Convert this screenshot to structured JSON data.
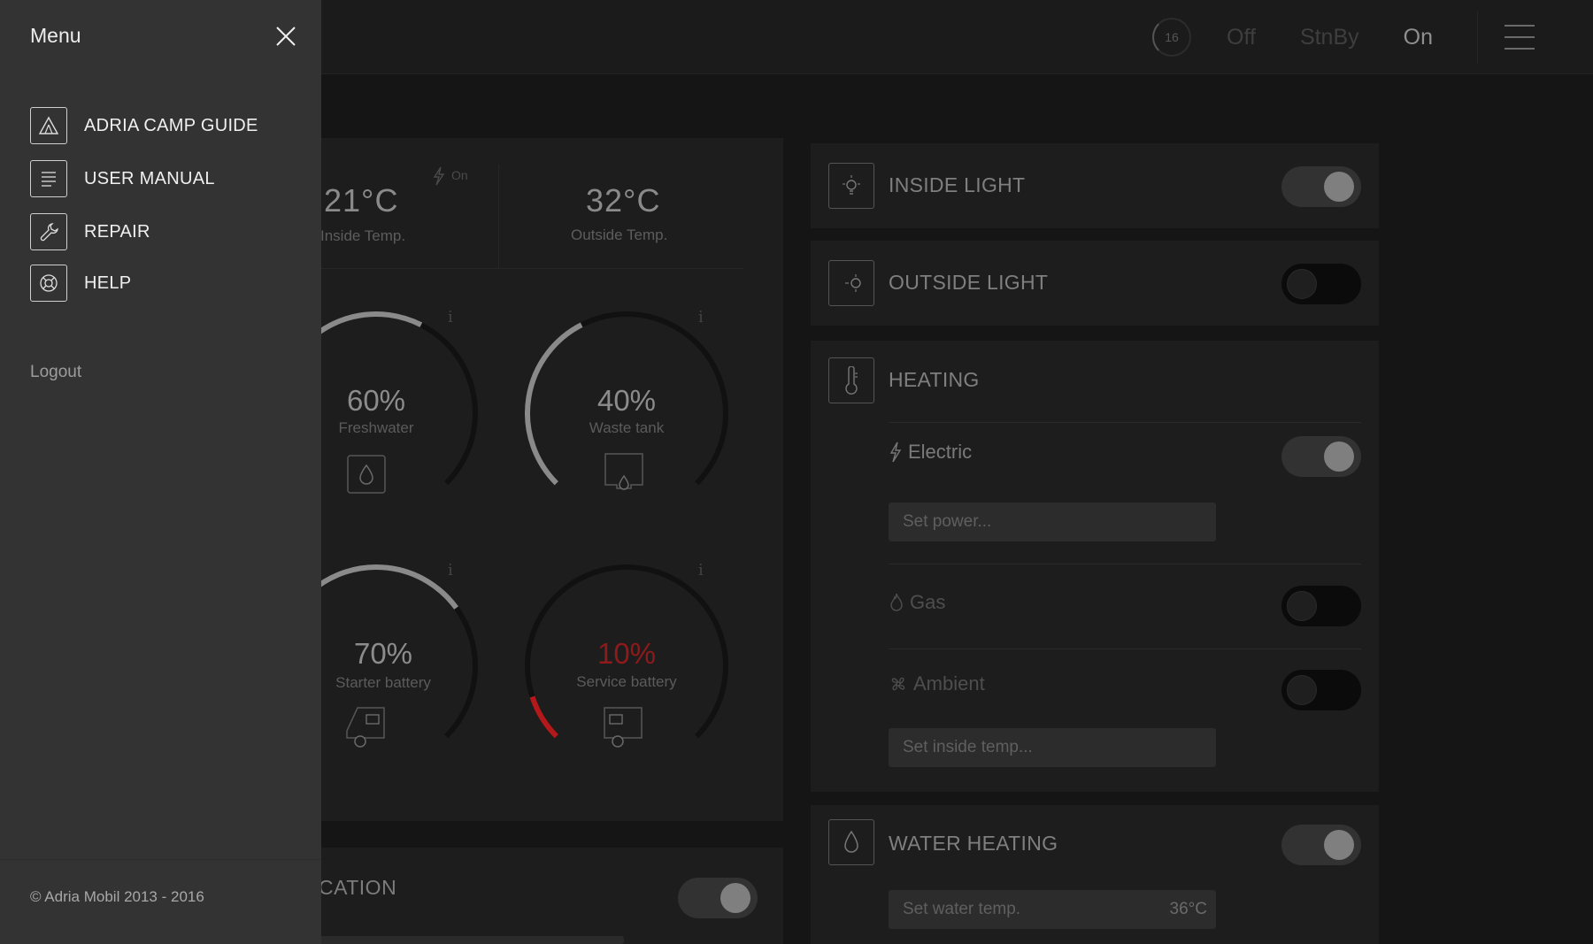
{
  "topbar": {
    "badge": "16",
    "modes": [
      "Off",
      "StnBy",
      "On"
    ]
  },
  "climate": {
    "inside_value": "21°C",
    "inside_label": "Inside Temp.",
    "power_state": "On",
    "outside_value": "32°C",
    "outside_label": "Outside Temp."
  },
  "gauges": [
    {
      "value": "60%",
      "label": "Freshwater",
      "level": 0.6,
      "color": "#8a8a8a"
    },
    {
      "value": "40%",
      "label": "Waste tank",
      "level": 0.4,
      "color": "#8a8a8a"
    },
    {
      "value": "70%",
      "label": "Starter battery",
      "level": 0.7,
      "color": "#8a8a8a"
    },
    {
      "value": "10%",
      "label": "Service battery",
      "level": 0.1,
      "color": "#b3191b"
    }
  ],
  "lower_left": {
    "label": "CATION"
  },
  "right_panel": {
    "inside_light": {
      "title": "INSIDE LIGHT",
      "state": true
    },
    "outside_light": {
      "title": "OUTSIDE LIGHT",
      "state": false
    },
    "heating": {
      "title": "HEATING",
      "electric_label": "Electric",
      "electric_state": true,
      "power_placeholder": "Set power...",
      "gas_label": "Gas",
      "gas_state": false,
      "ambient_label": "Ambient",
      "ambient_state": false,
      "inside_temp_placeholder": "Set inside temp..."
    },
    "water_heating": {
      "title": "WATER HEATING",
      "state": true,
      "placeholder": "Set water temp.",
      "unit_value": "36°C"
    }
  },
  "menu": {
    "title": "Menu",
    "items": [
      {
        "label": "ADRIA CAMP GUIDE",
        "icon": "tent-icon"
      },
      {
        "label": "USER MANUAL",
        "icon": "document-icon"
      },
      {
        "label": "REPAIR",
        "icon": "wrench-icon"
      },
      {
        "label": "HELP",
        "icon": "lifebuoy-icon"
      }
    ],
    "logout": "Logout",
    "copyright": "© Adria Mobil 2013 - 2016"
  },
  "colors": {
    "background": "#151515",
    "panel": "#1d1d1d",
    "menu": "#333333",
    "alert": "#b3191b"
  }
}
